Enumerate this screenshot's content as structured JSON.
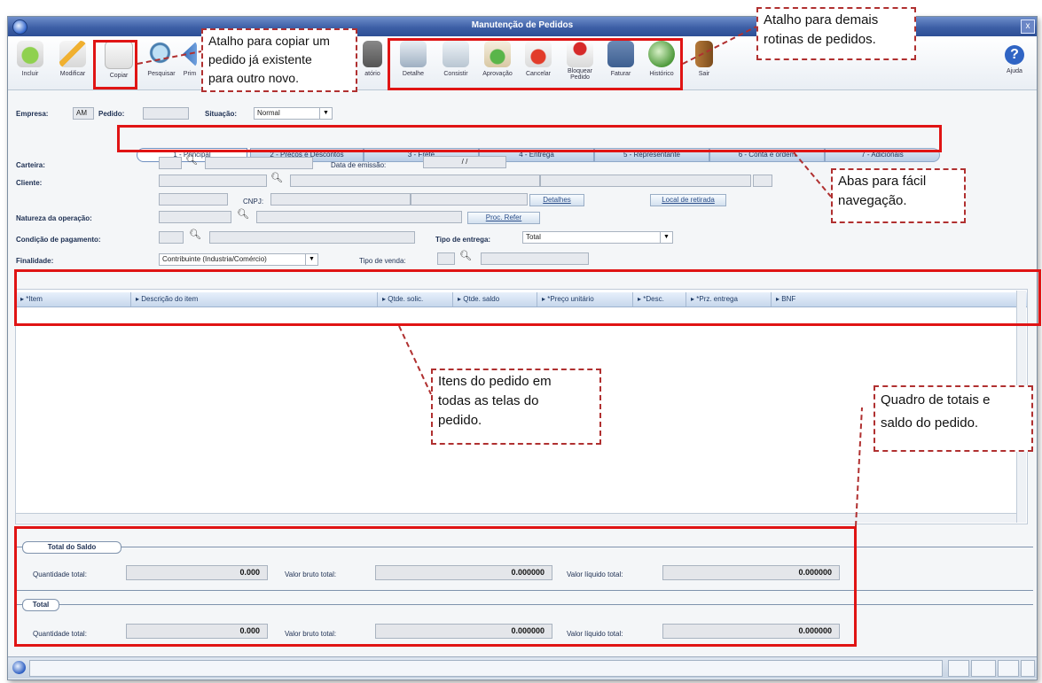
{
  "window": {
    "title": "Manutenção de Pedidos",
    "close": "x"
  },
  "toolbar": {
    "incluir": "Incluir",
    "modificar": "Modificar",
    "copiar": "Copiar",
    "pesquisar": "Pesquisar",
    "primeiro": "Prim",
    "relatorio": "atório",
    "detalhe": "Detalhe",
    "consistir": "Consistir",
    "aprovacao": "Aprovação",
    "cancelar": "Cancelar",
    "bloquear": "Bloquear",
    "bloquear2": "Pedido",
    "faturar": "Faturar",
    "historico": "Histórico",
    "sair": "Sair",
    "ajuda": "Ajuda"
  },
  "header": {
    "empresa_label": "Empresa:",
    "empresa_value": "AM",
    "pedido_label": "Pedido:",
    "pedido_value": "",
    "situacao_label": "Situação:",
    "situacao_value": "Normal"
  },
  "tabs": [
    "1 - Principal",
    "2 - Preços e Descontos",
    "3 - Frete",
    "4 - Entrega",
    "5 - Representante",
    "6 - Conta e ordem",
    "7 - Adicionais"
  ],
  "form": {
    "carteira": "Carteira:",
    "data_emissao": "Data de emissão:",
    "data_value": "/ /",
    "cliente": "Cliente:",
    "cnpj": "CNPJ:",
    "detalhes": "Detalhes",
    "local_retirada": "Local de retirada",
    "natureza": "Natureza da operação:",
    "proc_refer": "Proc. Refer",
    "condicao": "Condição de pagamento:",
    "tipo_entrega": "Tipo de entrega:",
    "tipo_entrega_value": "Total",
    "finalidade": "Finalidade:",
    "finalidade_value": "Contribuinte (Industria/Comércio)",
    "tipo_venda": "Tipo de venda:"
  },
  "grid": {
    "columns": [
      "*Item",
      "Descrição do item",
      "Qtde. solic.",
      "Qtde. saldo",
      "*Preço unitário",
      "*Desc.",
      "*Prz. entrega",
      "BNF"
    ]
  },
  "totals": {
    "saldo_legend": "Total do Saldo",
    "total_legend": "Total",
    "qtd_label": "Quantidade total:",
    "bruto_label": "Valor bruto total:",
    "liquido_label": "Valor líquido total:",
    "saldo_qtd": "0.000",
    "saldo_bruto": "0.000000",
    "saldo_liquido": "0.000000",
    "total_qtd": "0.000",
    "total_bruto": "0.000000",
    "total_liquido": "0.000000"
  },
  "callouts": {
    "copiar": [
      "Atalho para copiar um",
      "pedido já existente",
      "para outro novo."
    ],
    "rotinas": [
      "Atalho para demais",
      "rotinas de pedidos."
    ],
    "abas": [
      "Abas para fácil",
      "navegação."
    ],
    "itens": [
      "Itens do pedido em",
      "todas as telas do",
      "pedido."
    ],
    "totais": [
      "Quadro de totais e",
      "saldo do pedido."
    ]
  },
  "colors": {
    "annotation_red": "#e01414",
    "title_blue": "#3d5fa6"
  }
}
